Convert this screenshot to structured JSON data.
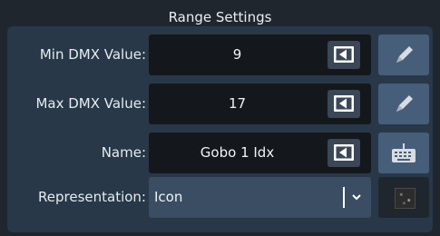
{
  "dialog": {
    "title": "Range Settings"
  },
  "fields": {
    "min": {
      "label": "Min DMX Value:",
      "value": "9"
    },
    "max": {
      "label": "Max DMX Value:",
      "value": "17"
    },
    "name": {
      "label": "Name:",
      "value": "Gobo 1 Idx"
    },
    "representation": {
      "label": "Representation:",
      "value": "Icon"
    }
  },
  "icons": {
    "backspace": "backspace-icon",
    "edit": "pencil-icon",
    "keyboard": "keyboard-icon",
    "dropdown": "chevron-down-icon",
    "preview": "gobo-thumbnail"
  },
  "colors": {
    "background": "#20262e",
    "panel": "#283848",
    "field": "#14181d",
    "button": "#465e7a",
    "select": "#3a4d62"
  }
}
